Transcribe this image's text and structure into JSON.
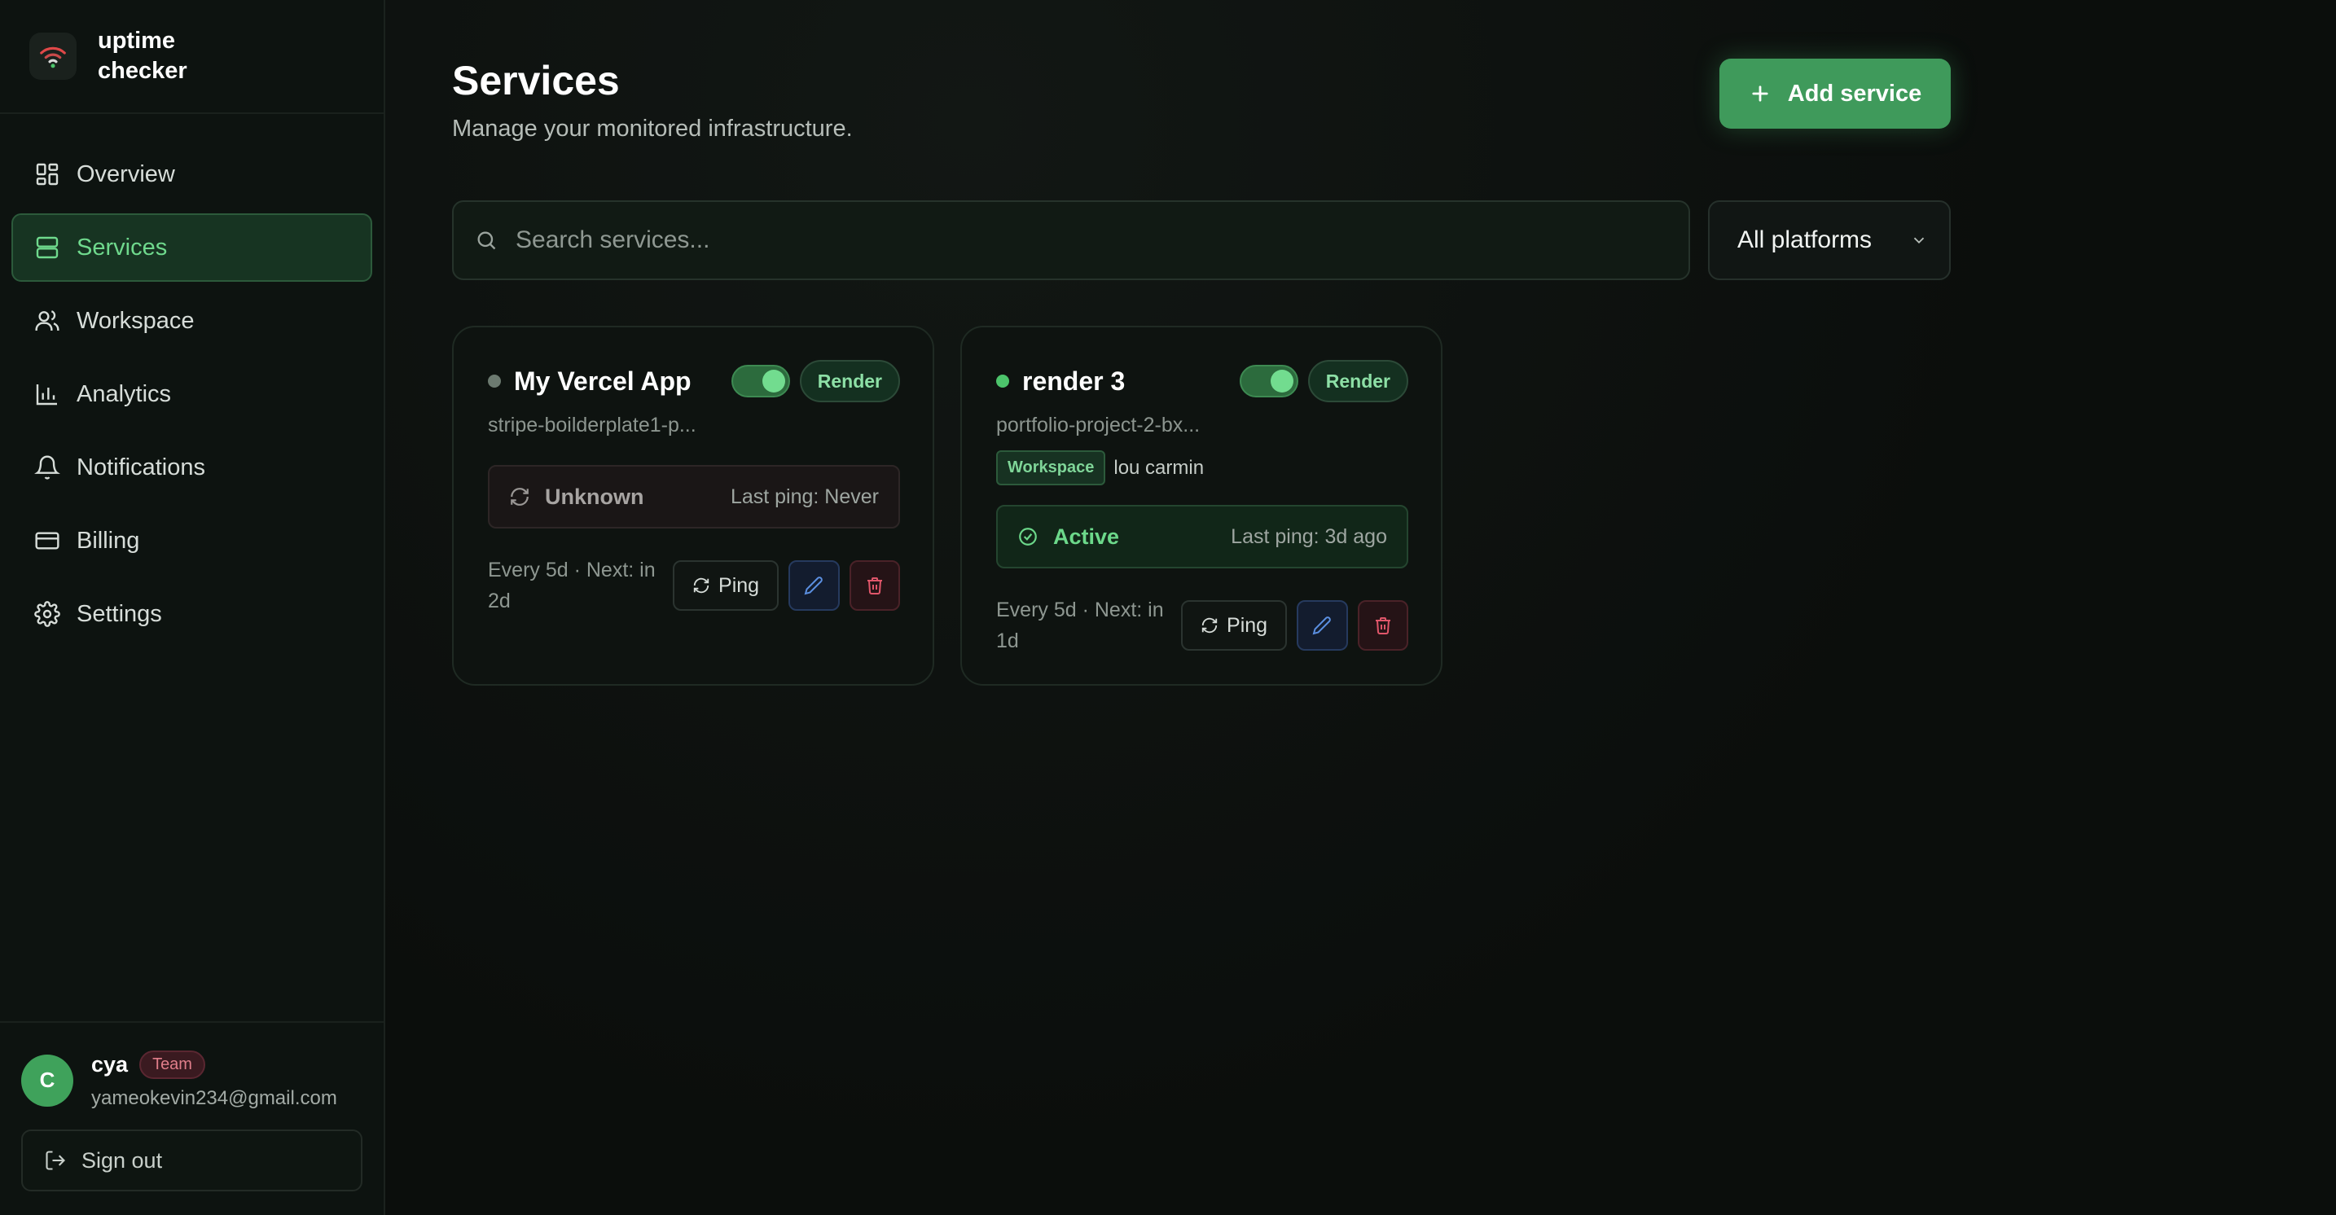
{
  "app": {
    "name": "uptime checker"
  },
  "sidebar": {
    "items": [
      {
        "label": "Overview",
        "icon": "dashboard-icon",
        "active": false
      },
      {
        "label": "Services",
        "icon": "server-icon",
        "active": true
      },
      {
        "label": "Workspace",
        "icon": "users-icon",
        "active": false
      },
      {
        "label": "Analytics",
        "icon": "bar-chart-icon",
        "active": false
      },
      {
        "label": "Notifications",
        "icon": "bell-icon",
        "active": false
      },
      {
        "label": "Billing",
        "icon": "credit-card-icon",
        "active": false
      },
      {
        "label": "Settings",
        "icon": "gear-icon",
        "active": false
      }
    ]
  },
  "user": {
    "initial": "C",
    "name": "cya",
    "plan": "Team",
    "email": "yameokevin234@gmail.com",
    "signout_label": "Sign out"
  },
  "header": {
    "title": "Services",
    "subtitle": "Manage your monitored infrastructure.",
    "add_label": "Add service"
  },
  "search": {
    "placeholder": "Search services..."
  },
  "filter": {
    "selected": "All platforms"
  },
  "services": [
    {
      "name": "My Vercel App",
      "subtitle": "stripe-boilderplate1-p...",
      "platform": "Render",
      "enabled": true,
      "status": "Unknown",
      "last_ping": "Last ping: Never",
      "schedule": "Every 5d · Next: in 2d",
      "ping_label": "Ping",
      "dot_color": "#6c7a70"
    },
    {
      "name": "render 3",
      "subtitle": "portfolio-project-2-bx...",
      "workspace_tag": "Workspace",
      "workspace_name": "lou carmin",
      "platform": "Render",
      "enabled": true,
      "status": "Active",
      "last_ping": "Last ping: 3d ago",
      "schedule": "Every 5d · Next: in 1d",
      "ping_label": "Ping",
      "dot_color": "#4cc46b"
    }
  ],
  "colors": {
    "accent": "#3f9a5b",
    "accent_text": "#6fd98d",
    "background": "#0c0f0d"
  }
}
